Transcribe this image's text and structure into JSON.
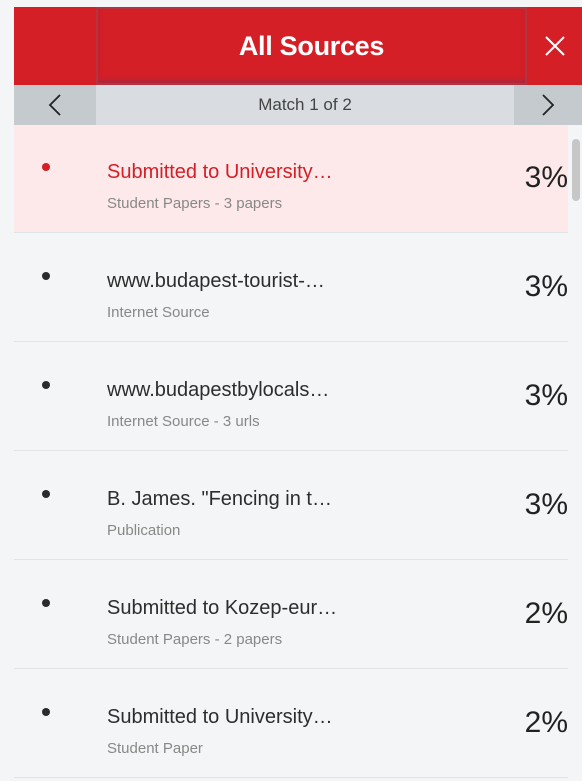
{
  "header": {
    "title": "All Sources",
    "close_icon": "close-icon"
  },
  "nav": {
    "prev_icon": "chevron-left-icon",
    "next_icon": "chevron-right-icon",
    "match_label": "Match 1 of 2"
  },
  "sources": [
    {
      "title": "Submitted to University…",
      "subtitle": "Student Papers - 3 papers",
      "percent": "3%",
      "active": true
    },
    {
      "title": "www.budapest-tourist-…",
      "subtitle": "Internet Source",
      "percent": "3%",
      "active": false
    },
    {
      "title": "www.budapestbylocals…",
      "subtitle": "Internet Source - 3 urls",
      "percent": "3%",
      "active": false
    },
    {
      "title": "B. James. \"Fencing in t…",
      "subtitle": "Publication",
      "percent": "3%",
      "active": false
    },
    {
      "title": "Submitted to Kozep-eur…",
      "subtitle": "Student Papers - 2 papers",
      "percent": "2%",
      "active": false
    },
    {
      "title": "Submitted to University…",
      "subtitle": "Student Paper",
      "percent": "2%",
      "active": false
    }
  ],
  "colors": {
    "brand_red": "#d41f26",
    "active_row": "#fde8ea"
  }
}
